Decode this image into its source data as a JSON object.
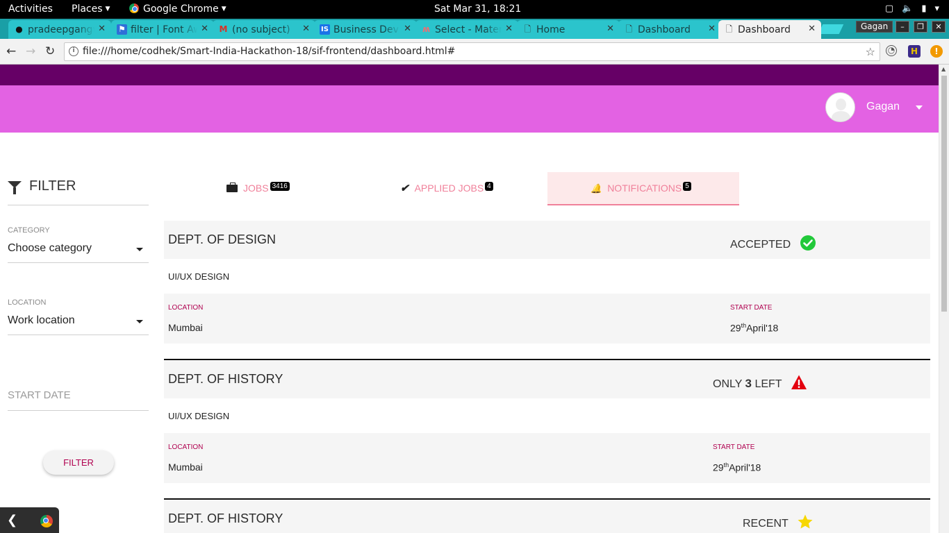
{
  "system": {
    "activities": "Activities",
    "places": "Places",
    "app": "Google Chrome",
    "clock": "Sat Mar 31, 18:21"
  },
  "tabs": [
    {
      "label": "pradeepgangw",
      "icon": "github-icon"
    },
    {
      "label": "filter | Font Awesome",
      "icon": "flag-icon"
    },
    {
      "label": "(no subject)",
      "icon": "gmail-icon"
    },
    {
      "label": "Business Dev",
      "icon": "is-icon"
    },
    {
      "label": "Select - Materialize",
      "icon": "materialize-icon"
    },
    {
      "label": "Home",
      "icon": "page-icon"
    },
    {
      "label": "Dashboard",
      "icon": "page-icon"
    },
    {
      "label": "Dashboard",
      "icon": "page-icon"
    }
  ],
  "window": {
    "user": "Gagan"
  },
  "address": {
    "url": "file:///home/codhek/Smart-India-Hackathon-18/sif-frontend/dashboard.html#"
  },
  "colors": {
    "band": "#660066",
    "header": "#e362e3",
    "accent": "#f0809a",
    "label": "#b0004f"
  },
  "header": {
    "user_name": "Gagan"
  },
  "filter": {
    "title": "FILTER",
    "category_label": "CATEGORY",
    "category_value": "Choose category",
    "location_label": "LOCATION",
    "location_value": "Work location",
    "start_date_placeholder": "START DATE",
    "button": "FILTER"
  },
  "page_tabs": [
    {
      "label": "JOBS",
      "count": "3416",
      "icon": "briefcase-icon"
    },
    {
      "label": "APPLIED JOBS",
      "count": "4",
      "icon": "check-icon"
    },
    {
      "label": "NOTIFICATIONS",
      "count": "5",
      "icon": "bell-icon",
      "active": true
    }
  ],
  "jobs": [
    {
      "title": "DEPT. OF DESIGN",
      "status": "ACCEPTED",
      "status_icon": "check-circle-icon",
      "subtitle": "UI/UX DESIGN",
      "location_label": "LOCATION",
      "location": "Mumbai",
      "start_label": "START DATE",
      "start_day": "29",
      "start_suffix": "th",
      "start_rest": "April'18"
    },
    {
      "title": "DEPT. OF HISTORY",
      "status_pre": "ONLY ",
      "status_num": "3",
      "status_post": " LEFT",
      "status_icon": "warning-icon",
      "subtitle": "UI/UX DESIGN",
      "location_label": "LOCATION",
      "location": "Mumbai",
      "start_label": "START DATE",
      "start_day": "29",
      "start_suffix": "th",
      "start_rest": "April'18"
    },
    {
      "title": "DEPT. OF HISTORY",
      "status": "RECENT",
      "status_icon": "star-icon"
    }
  ]
}
